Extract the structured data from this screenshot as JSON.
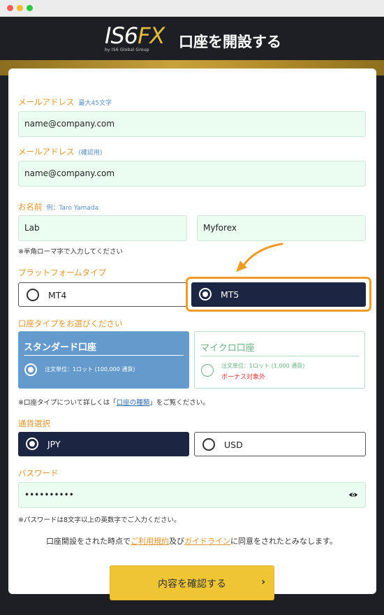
{
  "window": {
    "controls": [
      "close",
      "minimize",
      "maximize"
    ]
  },
  "header": {
    "logo_main": "IS6",
    "logo_accent": "FX",
    "logo_sub": "by IS6 Global Group",
    "title": "口座を開設する"
  },
  "form": {
    "email": {
      "label": "メールアドレス",
      "hint": "最大45文字",
      "value": "name@company.com"
    },
    "email_confirm": {
      "label": "メールアドレス",
      "hint": "(確認用)",
      "value": "name@company.com"
    },
    "name": {
      "label": "お名前",
      "hint": "例：Taro Yamada",
      "first_value": "Lab",
      "last_value": "Myforex",
      "note": "※半角ローマ字で入力してください"
    },
    "platform": {
      "label": "プラットフォームタイプ",
      "options": [
        {
          "label": "MT4",
          "selected": false
        },
        {
          "label": "MT5",
          "selected": true
        }
      ]
    },
    "account_type": {
      "label": "口座タイプをお選びください",
      "standard": {
        "title": "スタンダード口座",
        "desc": "注文単位：1ロット (100,000 通貨)",
        "selected": true
      },
      "micro": {
        "title": "マイクロ口座",
        "desc": "注文単位：1ロット (1,000 通貨)",
        "bonus": "ボーナス対象外",
        "selected": false
      },
      "note_prefix": "※口座タイプについて詳しくは「",
      "note_link": "口座の種類",
      "note_suffix": "」をご覧ください。"
    },
    "currency": {
      "label": "通貨選択",
      "options": [
        {
          "label": "JPY",
          "selected": true
        },
        {
          "label": "USD",
          "selected": false
        }
      ]
    },
    "password": {
      "label": "パスワード",
      "value": "••••••••••",
      "note": "※パスワードは8文字以上の英数字でご入力ください。"
    },
    "agreement": {
      "prefix": "口座開設をされた時点で",
      "terms_link": "ご利用規約",
      "and": "及び",
      "guide_link": "ガイドライン",
      "suffix": "に同意をされたとみなします。"
    },
    "submit_label": "内容を確認する",
    "submit_chevron": "›"
  },
  "colors": {
    "accent_orange": "#e3962f",
    "navy": "#1c2541",
    "input_bg": "#ebfdf0",
    "standard_blue": "#649bcc",
    "submit_yellow": "#efc535",
    "gold_band": "#c9a13b"
  }
}
